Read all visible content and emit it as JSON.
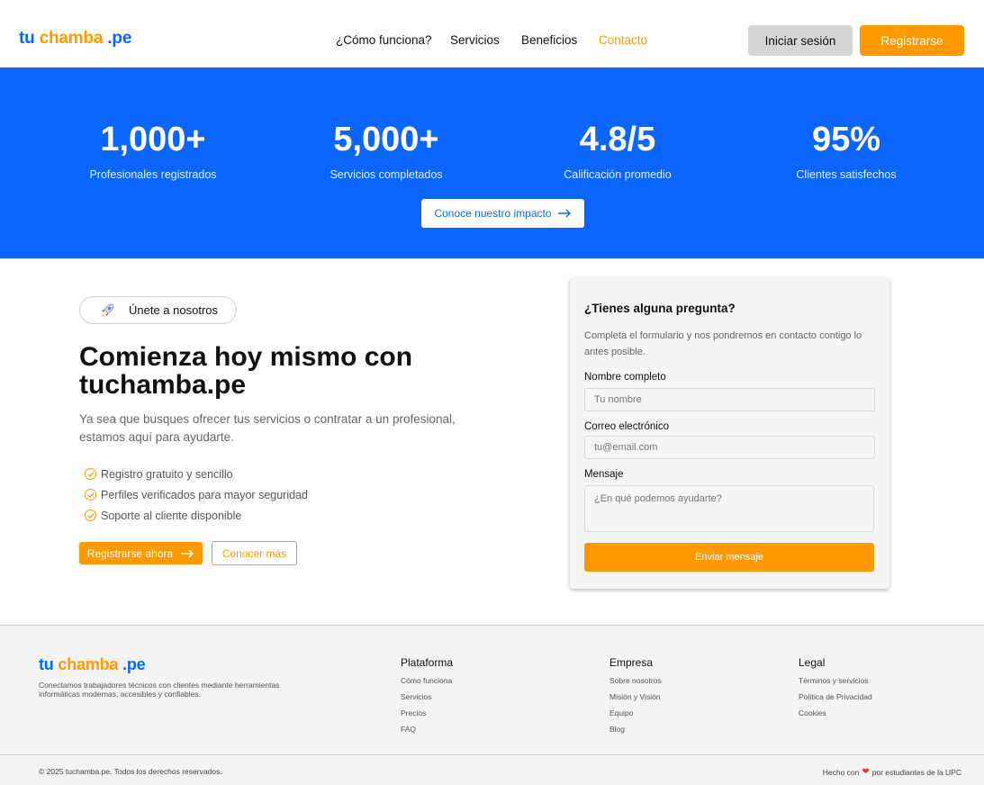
{
  "brand": {
    "tu": "tu",
    "chamba": "chamba",
    "pe": ".pe"
  },
  "nav": {
    "items": [
      {
        "label": "¿Cómo funciona?"
      },
      {
        "label": "Servicios"
      },
      {
        "label": "Beneficios"
      },
      {
        "label": "Contacto",
        "active": true
      }
    ],
    "login_label": "Iniciar sesión",
    "register_label": "Registrarse"
  },
  "stats": {
    "items": [
      {
        "value": "1,000+",
        "label": "Profesionales registrados"
      },
      {
        "value": "5,000+",
        "label": "Servicios completados"
      },
      {
        "value": "4.8/5",
        "label": "Calificación promedio"
      },
      {
        "value": "95%",
        "label": "Clientes satisfechos"
      }
    ],
    "impact_button": "Conoce nuestro impacto"
  },
  "cta": {
    "pill_icon": "rocket-icon",
    "pill_label": "Únete a nosotros",
    "headline_line1": "Comienza hoy mismo con",
    "headline_line2": "tuchamba.pe",
    "subtitle": "Ya sea que busques ofrecer tus servicios o contratar a un profesional, estamos aquí para ayudarte.",
    "checks": [
      "Registro gratuito y sencillo",
      "Perfiles verificados para mayor seguridad",
      "Soporte al cliente disponible"
    ],
    "primary_button": "Registrarse ahora",
    "secondary_button": "Conocer más"
  },
  "contact_form": {
    "title": "¿Tienes alguna pregunta?",
    "description": "Completa el formulario y nos pondremos en contacto contigo lo antes posible.",
    "name_label": "Nombre completo",
    "name_placeholder": "Tu nombre",
    "email_label": "Correo electrónico",
    "email_placeholder": "tu@email.com",
    "message_label": "Mensaje",
    "message_placeholder": "¿En qué podemos ayudarte?",
    "submit_label": "Enviar mensaje"
  },
  "footer": {
    "tagline": "Conectamos trabajadores técnicos con clientes mediante herramientas informáticas modernas, accesibles y confiables.",
    "columns": [
      {
        "title": "Plataforma",
        "links": [
          "Cómo funciona",
          "Servicios",
          "Precios",
          "FAQ"
        ]
      },
      {
        "title": "Empresa",
        "links": [
          "Sobre nosotros",
          "Misión y Visión",
          "Equipo",
          "Blog"
        ]
      },
      {
        "title": "Legal",
        "links": [
          "Términos y servicios",
          "Política de Privacidad",
          "Cookies"
        ]
      }
    ],
    "copyright": "© 2025 tuchamba.pe. Todos los derechos reservados.",
    "made_prefix": "Hecho con",
    "made_suffix": "por estudiantes de la UPC"
  },
  "colors": {
    "primary_blue": "#0a66ff",
    "accent_orange": "#ff9900"
  }
}
